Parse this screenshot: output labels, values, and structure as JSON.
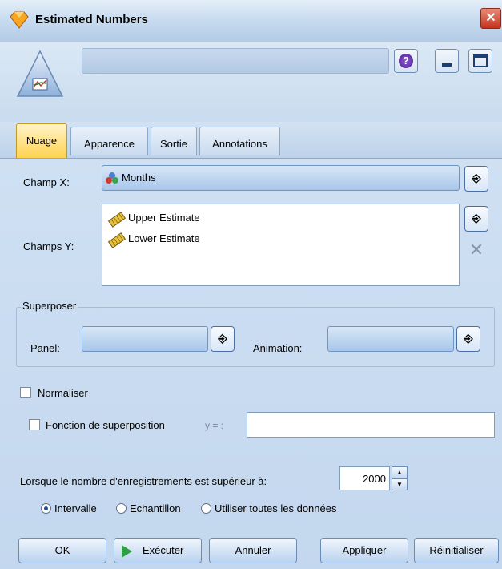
{
  "window": {
    "title": "Estimated Numbers",
    "close_glyph": "✕"
  },
  "header": {
    "help_glyph": "?",
    "minimize_glyph": "_",
    "maximize_glyph": ""
  },
  "tabs": [
    {
      "label": "Nuage",
      "active": true
    },
    {
      "label": "Apparence",
      "active": false
    },
    {
      "label": "Sortie",
      "active": false
    },
    {
      "label": "Annotations",
      "active": false
    }
  ],
  "fields": {
    "x_label": "Champ X:",
    "x_value": "Months",
    "y_label": "Champs Y:",
    "y_values": [
      "Upper Estimate",
      "Lower Estimate"
    ]
  },
  "overlay": {
    "legend": "Superposer",
    "panel_label": "Panel:",
    "animation_label": "Animation:"
  },
  "options": {
    "normalize_label": "Normaliser",
    "overlay_function_label": "Fonction de superposition",
    "y_eq_label": "y = :",
    "record_threshold_label": "Lorsque le nombre d'enregistrements est supérieur à:",
    "record_threshold_value": "2000",
    "radio_options": [
      {
        "label": "Intervalle",
        "selected": true
      },
      {
        "label": "Echantillon",
        "selected": false
      },
      {
        "label": "Utiliser toutes les données",
        "selected": false
      }
    ]
  },
  "buttons": {
    "ok": "OK",
    "execute": "Exécuter",
    "cancel": "Annuler",
    "apply": "Appliquer",
    "reset": "Réinitialiser"
  },
  "colors": {
    "active_tab": "#ffd24d",
    "close_button": "#c4331c",
    "execute_arrow": "#2ea043"
  }
}
